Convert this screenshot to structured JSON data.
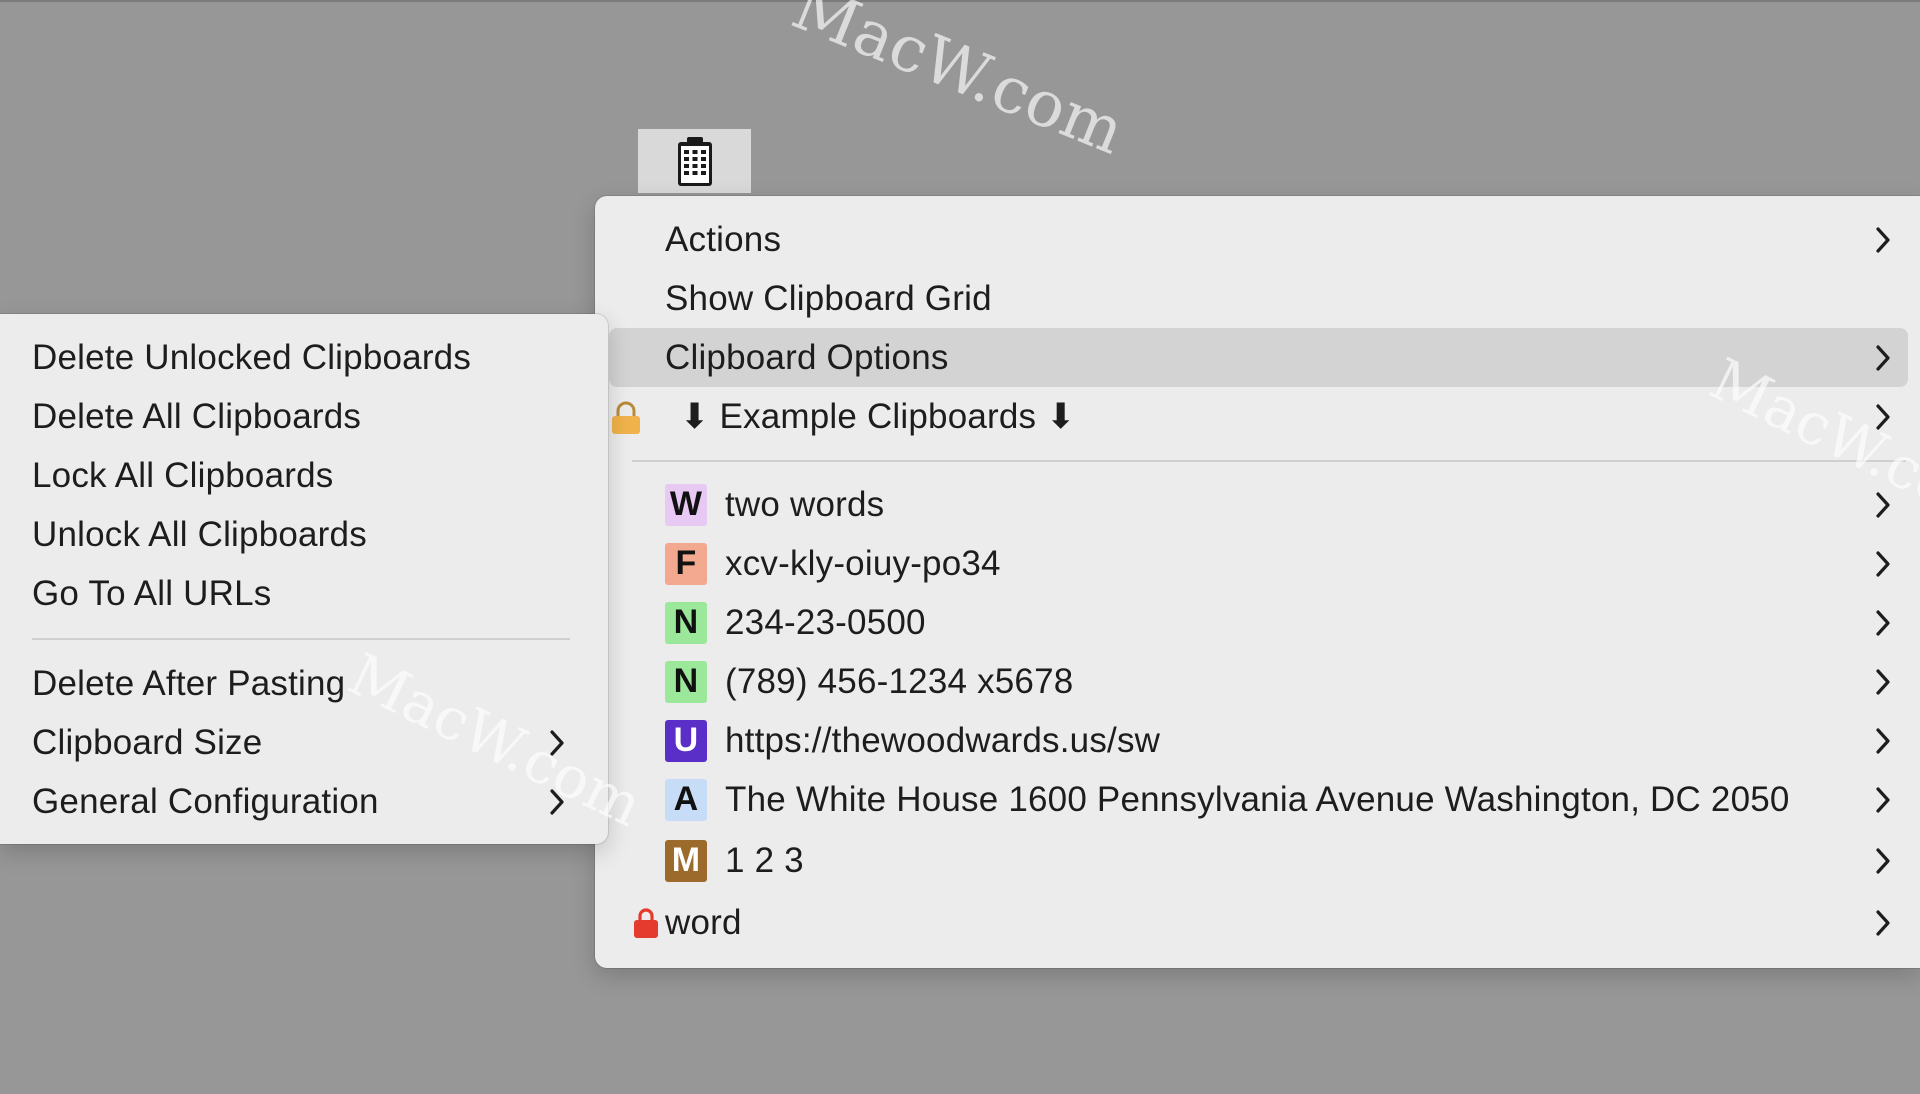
{
  "watermark": "MacW.com",
  "main_menu": {
    "items": [
      {
        "label": "Actions",
        "has_submenu": true
      },
      {
        "label": "Show Clipboard Grid",
        "has_submenu": false
      },
      {
        "label": "Clipboard Options",
        "has_submenu": true,
        "highlighted": true
      },
      {
        "label": "⬇ Example Clipboards ⬇",
        "has_submenu": true,
        "locked": true
      }
    ],
    "clipboards": [
      {
        "badge": "W",
        "badge_color": "#e7c9f3",
        "badge_text_color": "#111111",
        "label": "two words"
      },
      {
        "badge": "F",
        "badge_color": "#f2a98f",
        "badge_text_color": "#111111",
        "label": "xcv-kly-oiuy-po34"
      },
      {
        "badge": "N",
        "badge_color": "#9be89a",
        "badge_text_color": "#111111",
        "label": "234-23-0500"
      },
      {
        "badge": "N",
        "badge_color": "#9be89a",
        "badge_text_color": "#111111",
        "label": "(789) 456-1234 x5678"
      },
      {
        "badge": "U",
        "badge_color": "#5a2fc8",
        "badge_text_color": "#ffffff",
        "label": "https://thewoodwards.us/sw"
      },
      {
        "badge": "A",
        "badge_color": "#c7dcf6",
        "badge_text_color": "#111111",
        "label": "The White House 1600 Pennsylvania Avenue Washington, DC 2050"
      },
      {
        "badge": "M",
        "badge_color": "#9c6a2a",
        "badge_text_color": "#ffffff",
        "label": "1 2 3"
      }
    ],
    "locked_item": {
      "label": "word"
    }
  },
  "sub_menu": {
    "group1": [
      {
        "label": "Delete Unlocked Clipboards"
      },
      {
        "label": "Delete All Clipboards"
      },
      {
        "label": "Lock All Clipboards"
      },
      {
        "label": "Unlock All Clipboards"
      },
      {
        "label": "Go To All URLs"
      }
    ],
    "group2": [
      {
        "label": "Delete After Pasting",
        "has_submenu": false
      },
      {
        "label": "Clipboard Size",
        "has_submenu": true
      },
      {
        "label": "General Configuration",
        "has_submenu": true
      }
    ]
  },
  "colors": {
    "background": "#979797",
    "menu": "#ececec",
    "highlight": "#d3d3d3",
    "lock_red": "#e53b2f",
    "lock_gold": "#f0b24a"
  },
  "icons": {
    "menubar": "clipboard-icon",
    "submenu": "chevron-right-icon",
    "lock": "lock-icon"
  }
}
